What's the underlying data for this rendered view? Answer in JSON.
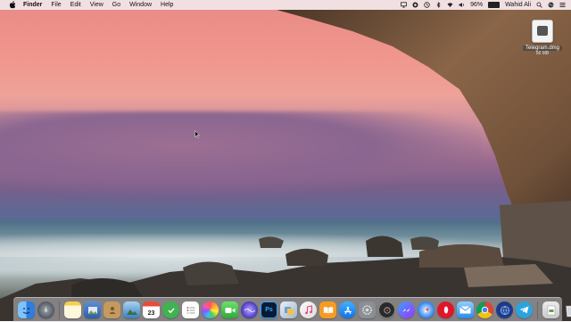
{
  "menubar": {
    "app_name": "Finder",
    "items": [
      "File",
      "Edit",
      "View",
      "Go",
      "Window",
      "Help"
    ],
    "battery_text": "96%",
    "battery_level": 0.96,
    "user": "Wahid Ali",
    "icons": [
      "apple-icon",
      "screen-mirroring-icon",
      "creative-cloud-icon",
      "time-machine-icon",
      "bluetooth-icon",
      "wifi-icon",
      "volume-icon",
      "battery-icon",
      "spotlight-icon",
      "siri-icon",
      "notification-center-icon"
    ]
  },
  "desktop": {
    "file_name": "Telegram.dmg",
    "file_size": "56 MB"
  },
  "dock": {
    "apps": [
      {
        "name": "finder-icon",
        "label": ""
      },
      {
        "name": "launchpad-icon",
        "label": ""
      },
      {
        "name": "notes-icon",
        "label": ""
      },
      {
        "name": "preview-icon",
        "label": ""
      },
      {
        "name": "contacts-icon",
        "label": ""
      },
      {
        "name": "iphoto-icon",
        "label": ""
      },
      {
        "name": "calendar-icon",
        "label": "23"
      },
      {
        "name": "mindnode-icon",
        "label": ""
      },
      {
        "name": "reminders-icon",
        "label": ""
      },
      {
        "name": "photos-icon",
        "label": ""
      },
      {
        "name": "facetime-icon",
        "label": ""
      },
      {
        "name": "siri-icon",
        "label": ""
      },
      {
        "name": "photoshop-icon",
        "label": "Ps"
      },
      {
        "name": "preview-images-icon",
        "label": ""
      },
      {
        "name": "itunes-icon",
        "label": ""
      },
      {
        "name": "books-icon",
        "label": ""
      },
      {
        "name": "app-store-icon",
        "label": ""
      },
      {
        "name": "system-preferences-icon",
        "label": ""
      },
      {
        "name": "screenflow-icon",
        "label": ""
      },
      {
        "name": "messenger-icon",
        "label": ""
      },
      {
        "name": "safari-icon",
        "label": ""
      },
      {
        "name": "opera-icon",
        "label": ""
      },
      {
        "name": "mail-icon",
        "label": ""
      },
      {
        "name": "chrome-icon",
        "label": ""
      },
      {
        "name": "network-icon",
        "label": ""
      },
      {
        "name": "telegram-icon",
        "label": ""
      },
      {
        "name": "downloads-icon",
        "label": ""
      },
      {
        "name": "trash-icon",
        "label": ""
      }
    ]
  }
}
